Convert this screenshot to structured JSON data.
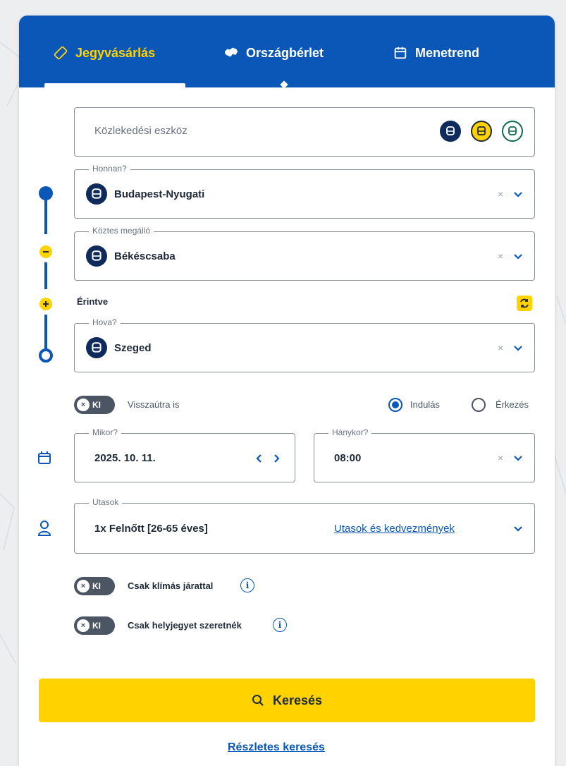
{
  "tabs": [
    {
      "label": "Jegyvásárlás",
      "icon": "ticket-icon",
      "active": true
    },
    {
      "label": "Országbérlet",
      "icon": "hungary-map-icon",
      "active": false
    },
    {
      "label": "Menetrend",
      "icon": "calendar-icon",
      "active": false
    }
  ],
  "transport": {
    "placeholder": "Közlekedési eszköz"
  },
  "from": {
    "legend": "Honnan?",
    "value": "Budapest-Nyugati"
  },
  "via": {
    "legend": "Köztes megálló",
    "value": "Békéscsaba",
    "touch_label": "Érintve"
  },
  "to": {
    "legend": "Hova?",
    "value": "Szeged"
  },
  "return_toggle": {
    "state": "KI",
    "label": "Visszaútra is"
  },
  "time_mode": {
    "departure": "Indulás",
    "arrival": "Érkezés",
    "selected": "departure"
  },
  "date": {
    "legend": "Mikor?",
    "value": "2025. 10. 11."
  },
  "time": {
    "legend": "Hánykor?",
    "value": "08:00"
  },
  "passengers": {
    "legend": "Utasok",
    "value": "1x Felnőtt [26-65 éves]",
    "link": "Utasok és kedvezmények"
  },
  "ac_toggle": {
    "state": "KI",
    "label": "Csak klímás járattal"
  },
  "seat_toggle": {
    "state": "KI",
    "label": "Csak helyjegyet szeretnék"
  },
  "search_button": {
    "label": "Keresés"
  },
  "detailed_search": {
    "label": "Részletes keresés"
  },
  "clear_symbol": "×",
  "colors": {
    "brand_blue": "#0a57b7",
    "accent_yellow": "#ffd200",
    "train_navy": "#0f2b5c",
    "bus_yellow": "#ffd200",
    "tram_green": "#0e6b4a"
  }
}
